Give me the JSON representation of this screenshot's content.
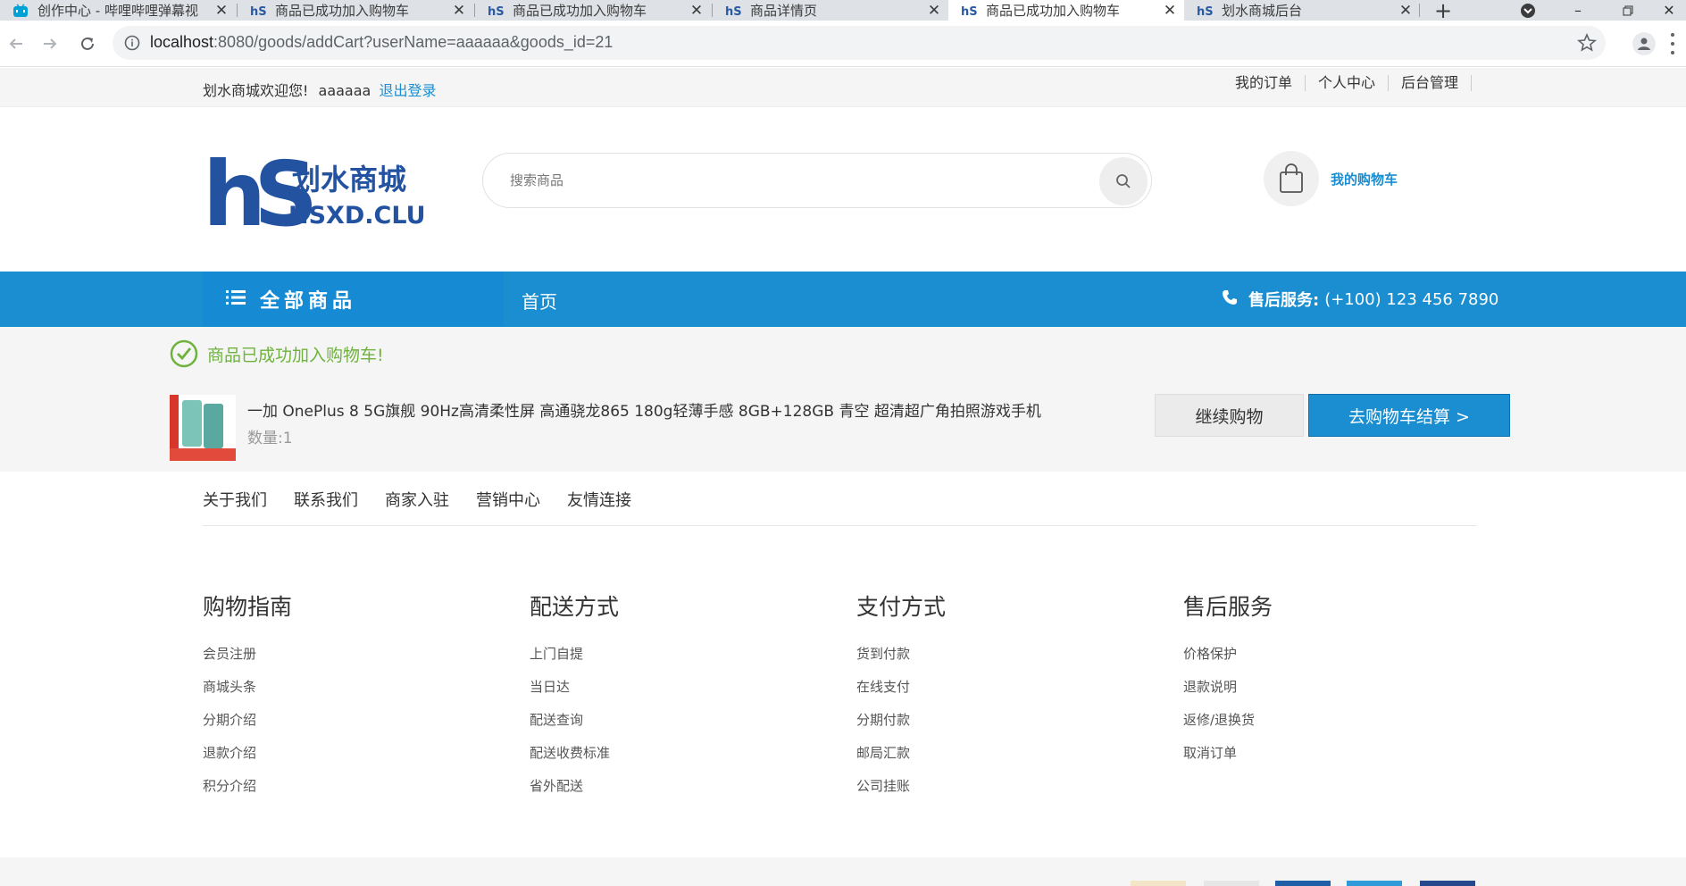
{
  "browser": {
    "tabs": [
      {
        "title": "创作中心 - 哔哩哔哩弹幕视",
        "icon": "bilibili-icon",
        "active": false
      },
      {
        "title": "商品已成功加入购物车",
        "icon": "site-logo-icon",
        "active": false
      },
      {
        "title": "商品已成功加入购物车",
        "icon": "site-logo-icon",
        "active": false
      },
      {
        "title": "商品详情页",
        "icon": "site-logo-icon",
        "active": false
      },
      {
        "title": "商品已成功加入购物车",
        "icon": "site-logo-icon",
        "active": true
      },
      {
        "title": "划水商城后台",
        "icon": "site-logo-icon",
        "active": false
      }
    ],
    "address": {
      "host": "localhost",
      "path": ":8080/goods/addCart?userName=aaaaaa&goods_id=21"
    }
  },
  "topbar": {
    "welcome": "划水商城欢迎您!",
    "username": "aaaaaa",
    "logout": "退出登录",
    "links": [
      "我的订单",
      "个人中心",
      "后台管理"
    ]
  },
  "header": {
    "logo_text": "划水商城",
    "logo_sub": "HSXD.CLUB",
    "search_placeholder": "搜索商品",
    "cart_label": "我的购物车"
  },
  "nav": {
    "all_goods": "全部商品",
    "home": "首页",
    "service_label": "售后服务:",
    "service_phone": "(+100) 123 456 7890"
  },
  "success": {
    "message": "商品已成功加入购物车!",
    "product_name": "一加 OnePlus 8 5G旗舰 90Hz高清柔性屏 高通骁龙865 180g轻薄手感 8GB+128GB 青空 超清超广角拍照游戏手机",
    "quantity": "数量:1",
    "continue_button": "继续购物",
    "checkout_button": "去购物车结算 >"
  },
  "footer": {
    "links": [
      "关于我们",
      "联系我们",
      "商家入驻",
      "营销中心",
      "友情连接"
    ],
    "columns": [
      {
        "title": "购物指南",
        "items": [
          "会员注册",
          "商城头条",
          "分期介绍",
          "退款介绍",
          "积分介绍"
        ]
      },
      {
        "title": "配送方式",
        "items": [
          "上门自提",
          "当日达",
          "配送查询",
          "配送收费标准",
          "省外配送"
        ]
      },
      {
        "title": "支付方式",
        "items": [
          "货到付款",
          "在线支付",
          "分期付款",
          "邮局汇款",
          "公司挂账"
        ]
      },
      {
        "title": "售后服务",
        "items": [
          "价格保护",
          "退款说明",
          "返修/退换货",
          "取消订单"
        ]
      }
    ]
  },
  "colors": {
    "primary": "#1a8ed0",
    "success": "#6fb23e"
  }
}
